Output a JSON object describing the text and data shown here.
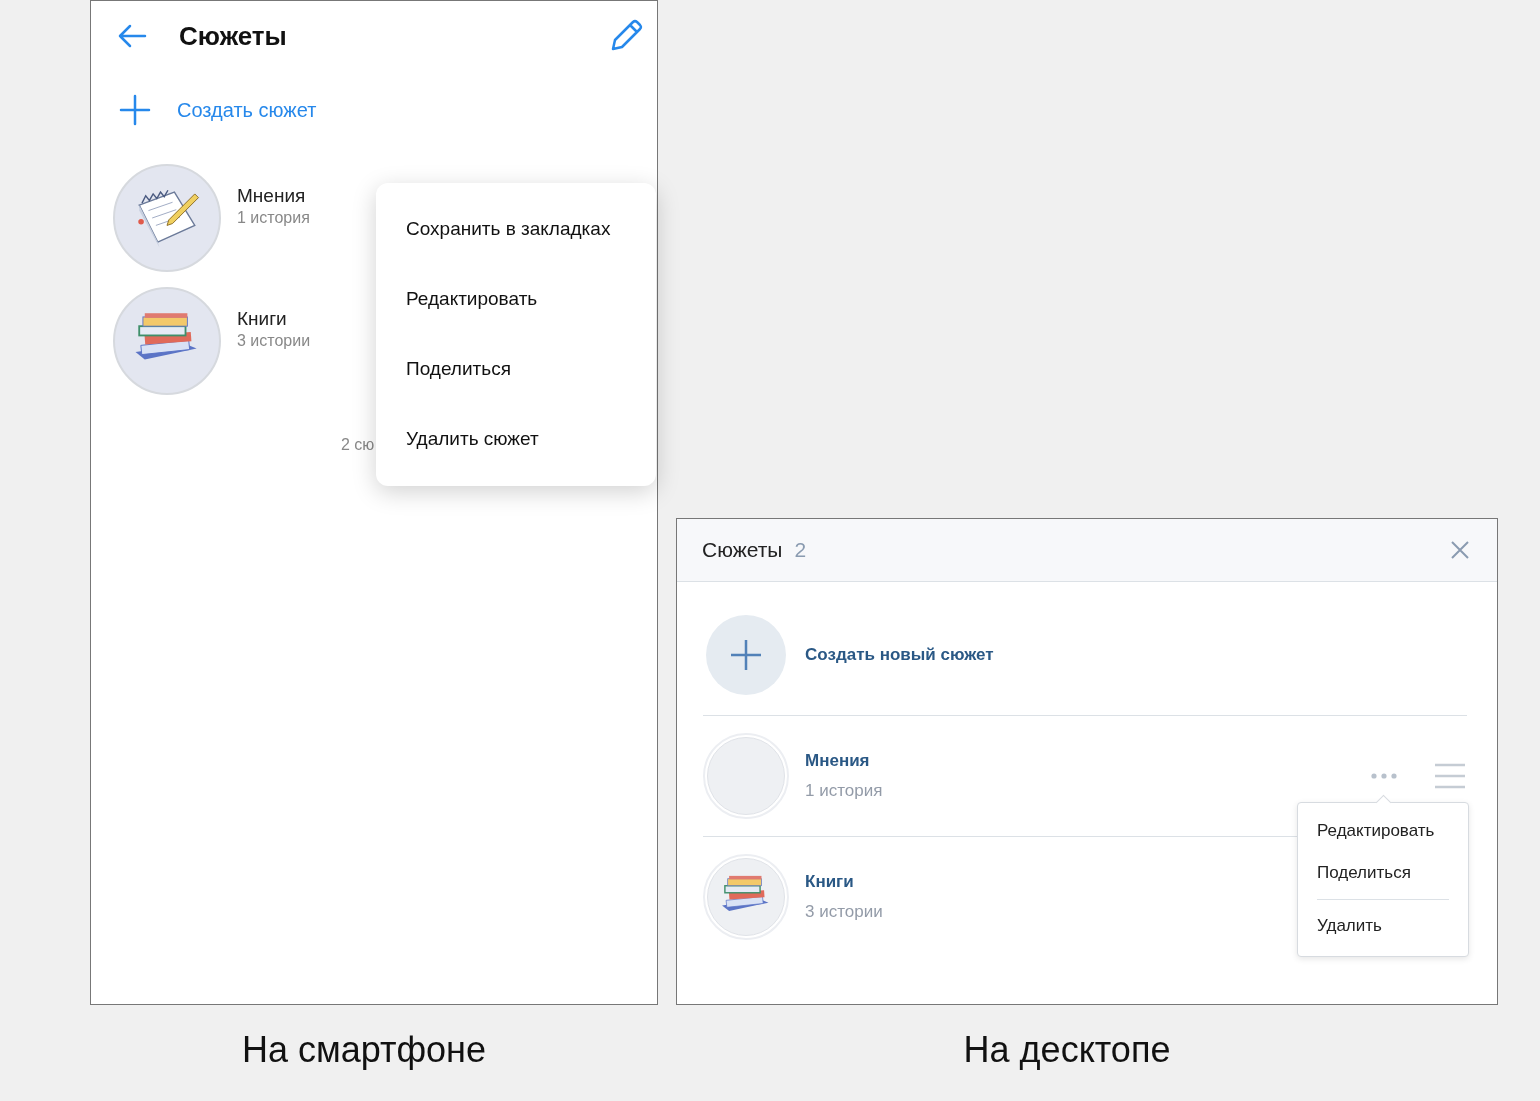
{
  "phone": {
    "title": "Сюжеты",
    "create_label": "Создать сюжет",
    "stories": [
      {
        "name": "Мнения",
        "count": "1 история",
        "kind": "notepad"
      },
      {
        "name": "Книги",
        "count": "3 истории",
        "kind": "books"
      }
    ],
    "footer": "2 сю",
    "context_menu": [
      "Сохранить в закладках",
      "Редактировать",
      "Поделиться",
      "Удалить сюжет"
    ],
    "caption": "На смартфоне"
  },
  "desktop": {
    "title": "Сюжеты",
    "count": "2",
    "create_label": "Создать новый сюжет",
    "stories": [
      {
        "name": "Мнения",
        "count": "1 история",
        "kind": "empty",
        "menu_open": true
      },
      {
        "name": "Книги",
        "count": "3 истории",
        "kind": "books",
        "menu_open": false
      }
    ],
    "dropdown": [
      {
        "label": "Редактировать",
        "divider_before": false
      },
      {
        "label": "Поделиться",
        "divider_before": false
      },
      {
        "label": "Удалить",
        "divider_before": true
      }
    ],
    "caption": "На десктопе"
  }
}
